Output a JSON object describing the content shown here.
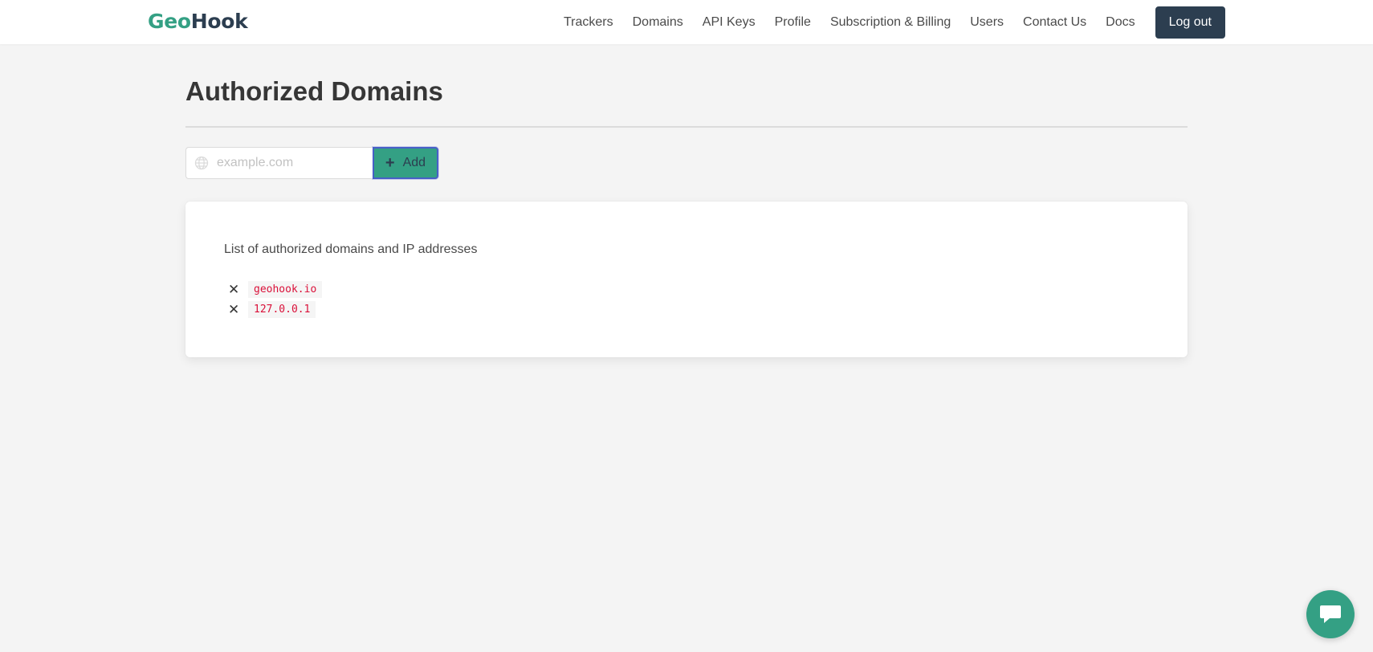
{
  "brand": {
    "part1": "Geo",
    "part2": "Hook"
  },
  "nav": {
    "items": [
      {
        "label": "Trackers"
      },
      {
        "label": "Domains"
      },
      {
        "label": "API Keys"
      },
      {
        "label": "Profile"
      },
      {
        "label": "Subscription & Billing"
      },
      {
        "label": "Users"
      },
      {
        "label": "Contact Us"
      },
      {
        "label": "Docs"
      }
    ],
    "logout_label": "Log out"
  },
  "page": {
    "title": "Authorized Domains"
  },
  "add_form": {
    "input_value": "",
    "placeholder": "example.com",
    "add_label": "Add",
    "input_icon": "globe-icon",
    "button_icon": "plus-icon"
  },
  "card": {
    "description": "List of authorized domains and IP addresses",
    "domains": [
      {
        "value": "geohook.io",
        "remove_icon": "close-icon"
      },
      {
        "value": "127.0.0.1",
        "remove_icon": "close-icon"
      }
    ]
  },
  "chat": {
    "icon": "chat-icon"
  },
  "colors": {
    "brand_green": "#34a084",
    "brand_dark": "#2c3e50",
    "code_red": "#da1039",
    "background": "#f4f4f4",
    "focus_border": "#485fc7"
  }
}
